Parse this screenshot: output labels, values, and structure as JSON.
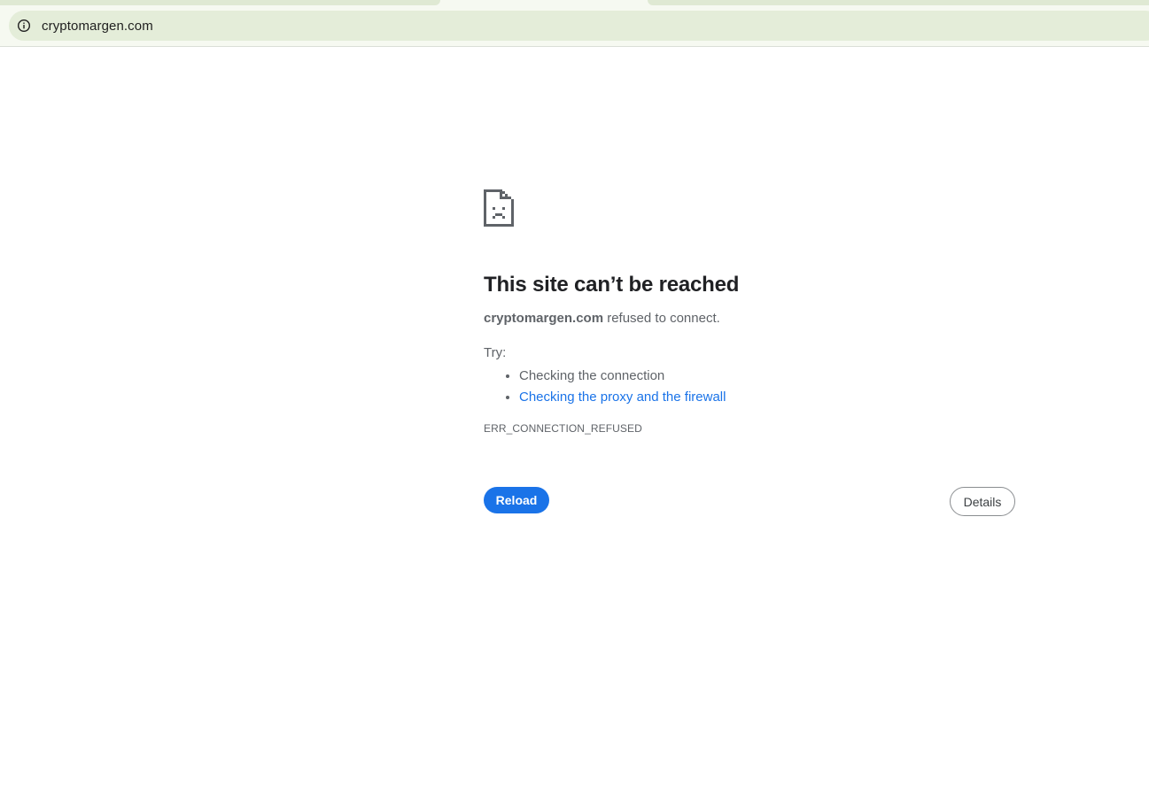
{
  "browser": {
    "url": "cryptomargen.com",
    "site_info_icon": "info-circle-icon"
  },
  "error_page": {
    "icon": "sad-page-icon",
    "heading": "This site can’t be reached",
    "summary_host": "cryptomargen.com",
    "summary_rest": " refused to connect.",
    "try_label": "Try:",
    "suggestions": [
      "Checking the connection",
      "Checking the proxy and the firewall"
    ],
    "error_code": "ERR_CONNECTION_REFUSED",
    "reload_label": "Reload",
    "details_label": "Details"
  },
  "colors": {
    "accent": "#1a73e8",
    "heading": "#202124",
    "body_text": "#5f6368",
    "omnibox_bg": "#e4edd9"
  }
}
